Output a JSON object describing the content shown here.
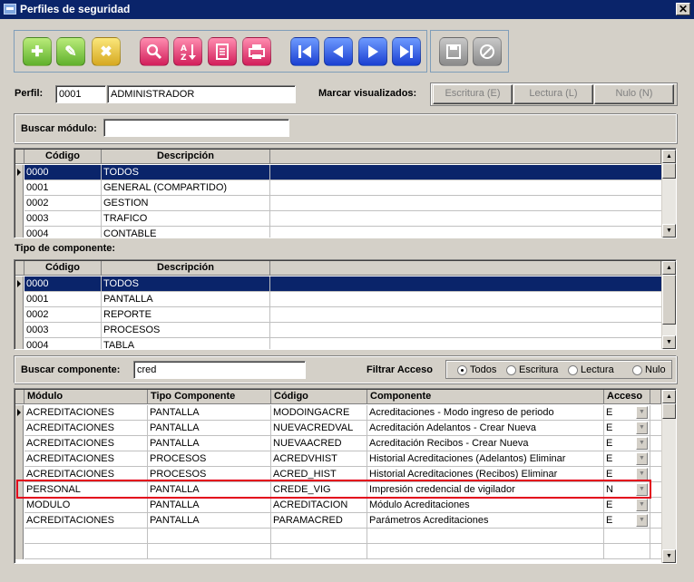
{
  "window": {
    "title": "Perfiles de seguridad"
  },
  "toolbar": {
    "icons": [
      "add-icon",
      "edit-icon",
      "delete-icon",
      "search-icon",
      "sort-icon",
      "report-icon",
      "print-icon",
      "first-icon",
      "prev-icon",
      "next-icon",
      "last-icon",
      "save-icon",
      "cancel-icon"
    ]
  },
  "perfil": {
    "label": "Perfil:",
    "code": "0001",
    "name": "ADMINISTRADOR"
  },
  "marcar": {
    "label": "Marcar visualizados:",
    "escritura": "Escritura (E)",
    "lectura": "Lectura (L)",
    "nulo": "Nulo (N)"
  },
  "buscar_modulo": {
    "label": "Buscar módulo:",
    "value": ""
  },
  "modulos": {
    "headers": [
      "Código",
      "Descripción"
    ],
    "rows": [
      [
        "0000",
        "TODOS"
      ],
      [
        "0001",
        "GENERAL (COMPARTIDO)"
      ],
      [
        "0002",
        "GESTION"
      ],
      [
        "0003",
        "TRAFICO"
      ],
      [
        "0004",
        "CONTABLE"
      ]
    ]
  },
  "tipo_componente": {
    "label": "Tipo de componente:",
    "headers": [
      "Código",
      "Descripción"
    ],
    "rows": [
      [
        "0000",
        "TODOS"
      ],
      [
        "0001",
        "PANTALLA"
      ],
      [
        "0002",
        "REPORTE"
      ],
      [
        "0003",
        "PROCESOS"
      ],
      [
        "0004",
        "TABLA"
      ]
    ]
  },
  "buscar_componente": {
    "label": "Buscar componente:",
    "value": "cred"
  },
  "filtrar_acceso": {
    "label": "Filtrar Acceso",
    "options": [
      "Todos",
      "Escritura",
      "Lectura",
      "Nulo"
    ],
    "selected": "Todos"
  },
  "componentes": {
    "headers": [
      "Módulo",
      "Tipo Componente",
      "Código",
      "Componente",
      "Acceso"
    ],
    "rows": [
      [
        "ACREDITACIONES",
        "PANTALLA",
        "MODOINGACRE",
        "Acreditaciones - Modo ingreso de periodo",
        "E"
      ],
      [
        "ACREDITACIONES",
        "PANTALLA",
        "NUEVACREDVAL",
        "Acreditación Adelantos - Crear Nueva",
        "E"
      ],
      [
        "ACREDITACIONES",
        "PANTALLA",
        "NUEVAACRED",
        "Acreditación Recibos - Crear Nueva",
        "E"
      ],
      [
        "ACREDITACIONES",
        "PROCESOS",
        "ACREDVHIST",
        "Historial Acreditaciones (Adelantos) Eliminar",
        "E"
      ],
      [
        "ACREDITACIONES",
        "PROCESOS",
        "ACRED_HIST",
        "Historial Acreditaciones (Recibos)  Eliminar",
        "E"
      ],
      [
        "PERSONAL",
        "PANTALLA",
        "CREDE_VIG",
        "Impresión credencial de vigilador",
        "N"
      ],
      [
        "MODULO",
        "PANTALLA",
        "ACREDITACION",
        "Módulo Acreditaciones",
        "E"
      ],
      [
        "ACREDITACIONES",
        "PANTALLA",
        "PARAMACRED",
        "Parámetros Acreditaciones",
        "E"
      ]
    ]
  },
  "colors": {
    "selection": "#0a246a",
    "highlight": "#e3001b",
    "face": "#d4d0c8"
  }
}
